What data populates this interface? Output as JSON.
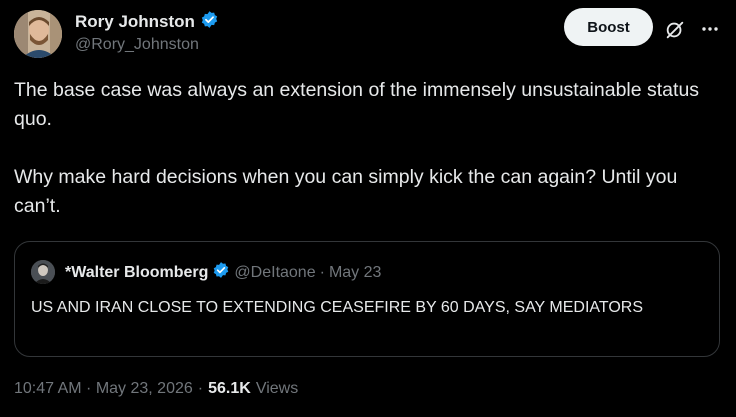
{
  "author": {
    "display_name": "Rory Johnston",
    "handle": "@Rory_Johnston",
    "verified_icon": "verified-badge-icon"
  },
  "actions": {
    "boost_label": "Boost",
    "grok_icon": "grok-icon",
    "more_icon": "more-icon"
  },
  "tweet": {
    "paragraph1": "The base case was always an extension of the immensely unsustainable status quo.",
    "paragraph2": "Why make hard decisions when you can simply kick the can again? Until you can’t."
  },
  "quote": {
    "display_name": "*Walter Bloomberg",
    "handle": "@DeItaone",
    "separator": "·",
    "date": "May 23",
    "text": "US AND IRAN CLOSE TO EXTENDING CEASEFIRE BY 60 DAYS, SAY MEDIATORS"
  },
  "meta": {
    "timestamp": "10:47 AM · May 23, 2026",
    "separator": "·",
    "views_count": "56.1K",
    "views_label": "Views"
  },
  "colors": {
    "verified": "#1d9bf0",
    "muted": "#71767b",
    "text": "#e7e9ea",
    "border": "#333639"
  }
}
